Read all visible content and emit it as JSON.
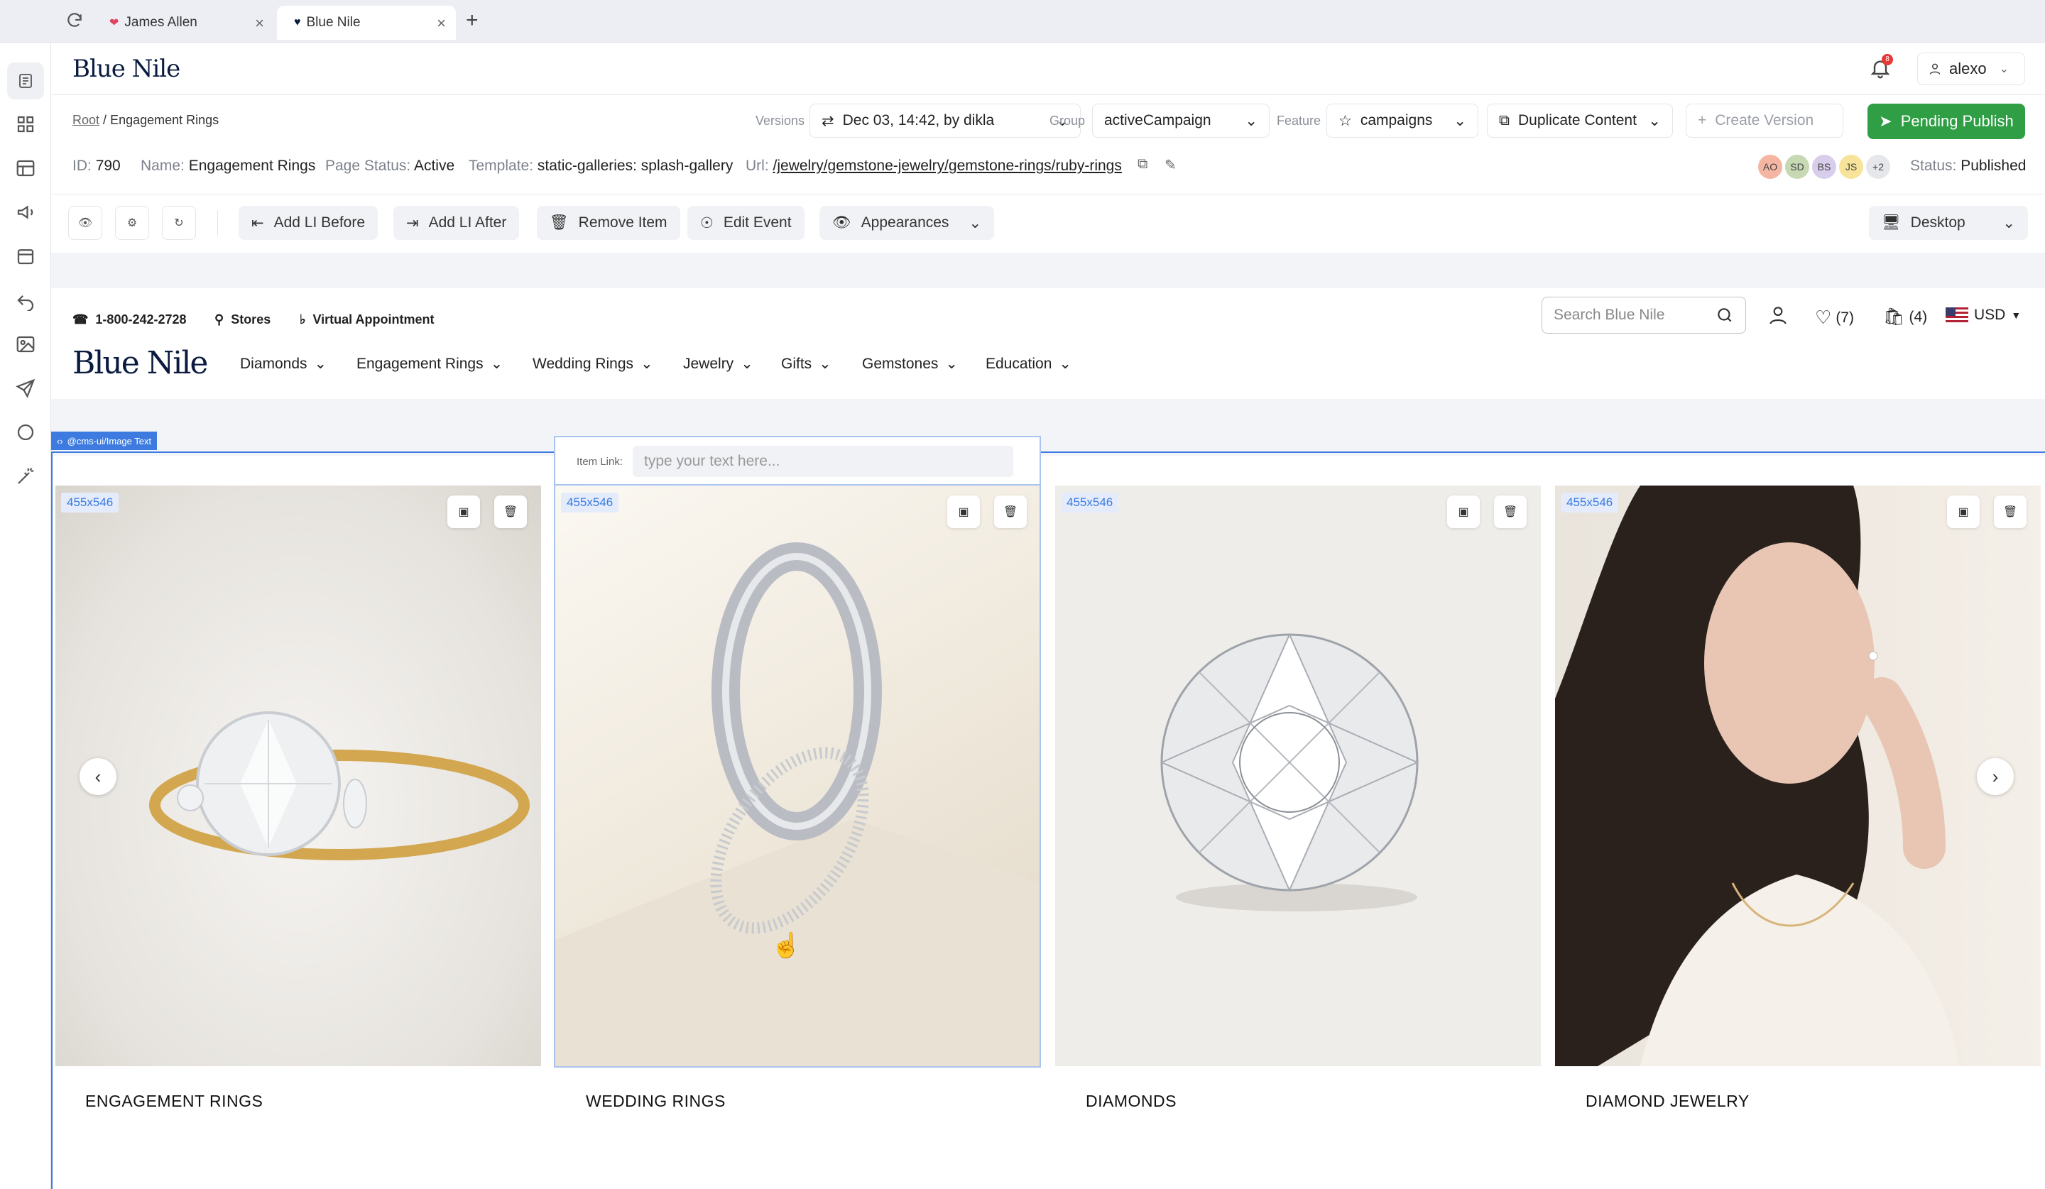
{
  "browser": {
    "tabs": [
      {
        "label": "James Allen",
        "active": false
      },
      {
        "label": "Blue Nile",
        "active": true
      }
    ]
  },
  "header": {
    "brand": "Blue Nile",
    "notification_count": "8",
    "user": "alexo"
  },
  "breadcrumb": {
    "root": "Root",
    "separator": "/",
    "current": "Engagement Rings"
  },
  "controls": {
    "versions_label": "Versions",
    "version_value": "Dec 03, 14:42, by dikla",
    "group_label": "Group",
    "group_value": "activeCampaign",
    "feature_label": "Feature",
    "feature_value": "campaigns",
    "duplicate": "Duplicate Content",
    "create_version": "Create Version",
    "publish": "Pending Publish"
  },
  "page_meta": {
    "id_label": "ID:",
    "id": "790",
    "name_label": "Name:",
    "name": "Engagement Rings",
    "status_label": "Page Status:",
    "status": "Active",
    "template_label": "Template:",
    "template": "static-galleries: splash-gallery",
    "url_label": "Url:",
    "url": "/jewelry/gemstone-jewelry/gemstone-rings/ruby-rings",
    "avatars": [
      "AO",
      "SD",
      "BS",
      "JS",
      "+2"
    ],
    "publish_status_label": "Status:",
    "publish_status": "Published"
  },
  "toolbar": {
    "add_before": "Add LI Before",
    "add_after": "Add LI After",
    "remove": "Remove Item",
    "edit_event": "Edit Event",
    "appearances": "Appearances",
    "device": "Desktop"
  },
  "site": {
    "phone": "1-800-242-2728",
    "stores": "Stores",
    "virtual": "Virtual Appointment",
    "search_placeholder": "Search Blue Nile",
    "wishlist": "(7)",
    "cart": "(4)",
    "currency": "USD",
    "logo": "Blue Nile",
    "nav": [
      "Diamonds",
      "Engagement Rings",
      "Wedding Rings",
      "Jewelry",
      "Gifts",
      "Gemstones",
      "Education"
    ]
  },
  "editor": {
    "component_tag": "@cms-ui/Image Text",
    "item_link_label": "Item Link:",
    "item_link_placeholder": "type your text here..."
  },
  "gallery": [
    {
      "size": "455x546",
      "caption": "ENGAGEMENT RINGS"
    },
    {
      "size": "455x546",
      "caption": "WEDDING RINGS"
    },
    {
      "size": "455x546",
      "caption": "DIAMONDS"
    },
    {
      "size": "455x546",
      "caption": "DIAMOND JEWELRY"
    }
  ],
  "colors": {
    "accent": "#3d7be0",
    "publish": "#2f9e44",
    "brand": "#0b1b3f"
  }
}
